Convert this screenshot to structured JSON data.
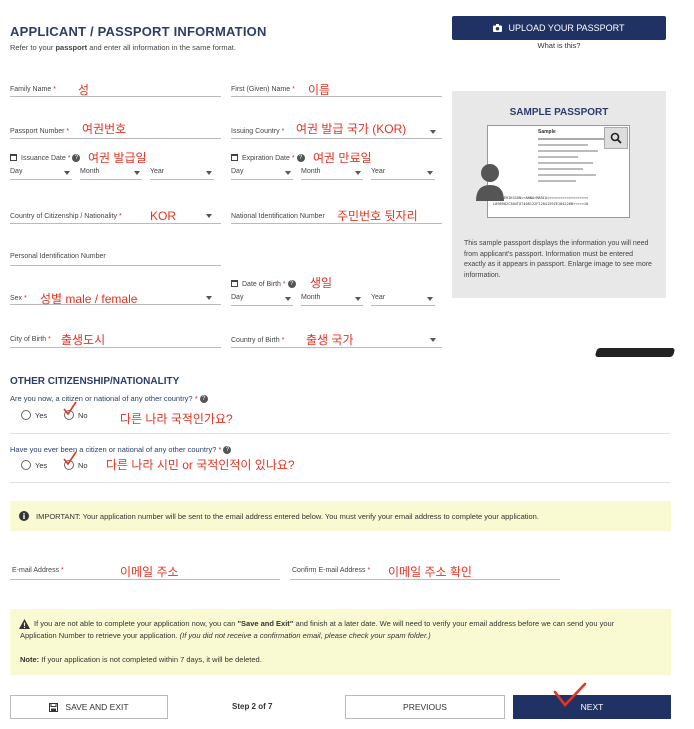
{
  "header": {
    "title": "APPLICANT / PASSPORT INFORMATION",
    "subtitle_pre": "Refer to your ",
    "subtitle_bold": "passport",
    "subtitle_post": " and enter all information in the same format.",
    "upload_label": "UPLOAD YOUR PASSPORT",
    "what_link": "What is this?"
  },
  "fields": {
    "family_name": {
      "label": "Family Name",
      "value": "성"
    },
    "first_name": {
      "label": "First (Given) Name",
      "value": "이름"
    },
    "passport_number": {
      "label": "Passport Number",
      "value": "여권번호"
    },
    "issuing_country": {
      "label": "Issuing Country",
      "value": "여권 발급 국가 (KOR)"
    },
    "issuance_date": {
      "label": "Issuance Date",
      "value": "여권 발급일"
    },
    "expiration_date": {
      "label": "Expiration Date",
      "value": "여권 만료일"
    },
    "citizenship": {
      "label": "Country of Citizenship / Nationality",
      "value": "KOR"
    },
    "national_id": {
      "label": "National Identification Number",
      "value": "주민번호 뒷자리"
    },
    "personal_id": {
      "label": "Personal Identification Number"
    },
    "dob": {
      "label": "Date of Birth",
      "value": "생일"
    },
    "sex": {
      "label": "Sex",
      "value": "성별 male / female"
    },
    "city_of_birth": {
      "label": "City of Birth",
      "value": "출생도시"
    },
    "country_of_birth": {
      "label": "Country of Birth",
      "value": "출생 국가"
    },
    "day": "Day",
    "month": "Month",
    "year": "Year",
    "required_mark": "*",
    "help_mark": "?"
  },
  "sample": {
    "title": "SAMPLE PASSPORT",
    "description": "This sample passport displays the information you will need from applicant's passport. Information must be entered exactly as it appears in passport. Enlarge image to see more information.",
    "doc_label": "Sample",
    "mrz1": "P<UTOERIKSSON<<ANNA<MARIA<<<<<<<<<<<<<<<<<<<",
    "mrz2": "L898902C36UTO7408122F1204159ZE184226B<<<<<10"
  },
  "other": {
    "title": "OTHER CITIZENSHIP/NATIONALITY",
    "q1": "Are you now, a citizen or national of any other country?",
    "q1_note": "다른 나라 국적인가요?",
    "q2": "Have you ever been a citizen or national of any other country?",
    "q2_note": "다른 나라 시민 or 국적인적이 있나요?",
    "yes": "Yes",
    "no": "No"
  },
  "email": {
    "important_prefix": "IMPORTANT:",
    "important": " Your application number will be sent to the email address entered below. You must verify your email address to complete your application.",
    "email_label": "E-mail Address",
    "email_value": "이메일 주소",
    "confirm_label": "Confirm E-mail Address",
    "confirm_value": "이메일 주소 확인"
  },
  "warning": {
    "line1_a": "If you are not able to complete your application now, you can ",
    "line1_b": "\"Save and Exit\"",
    "line1_c": " and finish at a later date. We will need to verify your email address before we can send you your",
    "line2_a": "Application Number to retrieve your application. ",
    "line2_b": "(If you did not receive a confirmation email, please check your spam folder.)",
    "note_label": "Note:",
    "note": " If your application is not completed within 7 days, it will be deleted."
  },
  "footer": {
    "save": "SAVE AND EXIT",
    "step": "Step 2 of 7",
    "previous": "PREVIOUS",
    "next": "NEXT"
  }
}
